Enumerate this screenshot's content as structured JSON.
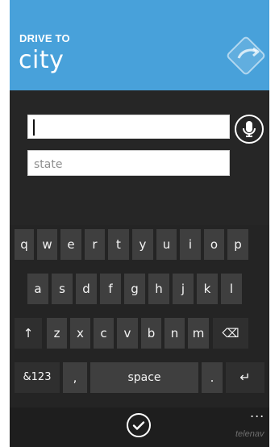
{
  "header": {
    "kicker": "DRIVE TO",
    "title": "city",
    "logo_icon": "telenav-navigation-logo-icon",
    "bg_color": "#48a1da"
  },
  "form": {
    "city_value": "",
    "state_placeholder": "state",
    "mic_icon": "microphone-icon"
  },
  "keyboard": {
    "row1": [
      "q",
      "w",
      "e",
      "r",
      "t",
      "y",
      "u",
      "i",
      "o",
      "p"
    ],
    "row2": [
      "a",
      "s",
      "d",
      "f",
      "g",
      "h",
      "j",
      "k",
      "l"
    ],
    "row3": {
      "shift_icon": "↑",
      "letters": [
        "z",
        "x",
        "c",
        "v",
        "b",
        "n",
        "m"
      ],
      "backspace_icon": "⌫"
    },
    "row4": {
      "symbols_label": "&123",
      "comma_label": ",",
      "space_label": "space",
      "period_label": ".",
      "enter_icon": "↵"
    }
  },
  "footer": {
    "check_icon": "✓",
    "more_label": "...",
    "brand": "telenav"
  }
}
